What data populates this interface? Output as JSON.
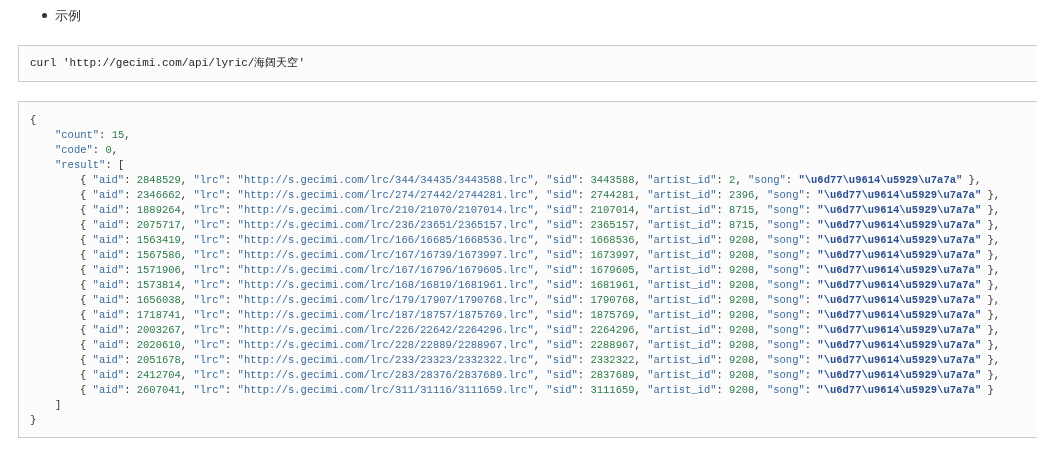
{
  "bullet": "示例",
  "command": "curl 'http://gecimi.com/api/lyric/海阔天空'",
  "code": {
    "lines": [
      {
        "tokens": [
          {
            "kind": "punct",
            "text": "{"
          }
        ],
        "children": [
          {
            "tokens": [
              {
                "kind": "key",
                "text": "\"count\""
              },
              {
                "kind": "punct",
                "text": ": "
              },
              {
                "kind": "num",
                "text": "15"
              },
              {
                "kind": "punct",
                "text": ","
              }
            ]
          },
          {
            "tokens": [
              {
                "kind": "key",
                "text": "\"code\""
              },
              {
                "kind": "punct",
                "text": ": "
              },
              {
                "kind": "num",
                "text": "0"
              },
              {
                "kind": "punct",
                "text": ","
              }
            ]
          },
          {
            "tokens": [
              {
                "kind": "key",
                "text": "\"result\""
              },
              {
                "kind": "punct",
                "text": ": ["
              }
            ],
            "children": [
              {
                "tokens": [
                  {
                    "kind": "punct",
                    "text": "{ "
                  },
                  {
                    "kind": "key",
                    "text": "\"aid\""
                  },
                  {
                    "kind": "punct",
                    "text": ": "
                  },
                  {
                    "kind": "num",
                    "text": "2848529"
                  },
                  {
                    "kind": "punct",
                    "text": ", "
                  },
                  {
                    "kind": "key",
                    "text": "\"lrc\""
                  },
                  {
                    "kind": "punct",
                    "text": ": "
                  },
                  {
                    "kind": "str",
                    "text": "\"http://s.gecimi.com/lrc/344/34435/3443588.lrc\""
                  },
                  {
                    "kind": "punct",
                    "text": ", "
                  },
                  {
                    "kind": "key",
                    "text": "\"sid\""
                  },
                  {
                    "kind": "punct",
                    "text": ": "
                  },
                  {
                    "kind": "num",
                    "text": "3443588"
                  },
                  {
                    "kind": "punct",
                    "text": ", "
                  },
                  {
                    "kind": "key",
                    "text": "\"artist_id\""
                  },
                  {
                    "kind": "punct",
                    "text": ": "
                  },
                  {
                    "kind": "num",
                    "text": "2"
                  },
                  {
                    "kind": "punct",
                    "text": ", "
                  },
                  {
                    "kind": "key",
                    "text": "\"song\""
                  },
                  {
                    "kind": "punct",
                    "text": ": "
                  },
                  {
                    "kind": "bold",
                    "text": "\"\\u6d77\\u9614\\u5929\\u7a7a\""
                  },
                  {
                    "kind": "punct",
                    "text": " },"
                  }
                ]
              },
              {
                "tokens": [
                  {
                    "kind": "punct",
                    "text": "{ "
                  },
                  {
                    "kind": "key",
                    "text": "\"aid\""
                  },
                  {
                    "kind": "punct",
                    "text": ": "
                  },
                  {
                    "kind": "num",
                    "text": "2346662"
                  },
                  {
                    "kind": "punct",
                    "text": ", "
                  },
                  {
                    "kind": "key",
                    "text": "\"lrc\""
                  },
                  {
                    "kind": "punct",
                    "text": ": "
                  },
                  {
                    "kind": "str",
                    "text": "\"http://s.gecimi.com/lrc/274/27442/2744281.lrc\""
                  },
                  {
                    "kind": "punct",
                    "text": ", "
                  },
                  {
                    "kind": "key",
                    "text": "\"sid\""
                  },
                  {
                    "kind": "punct",
                    "text": ": "
                  },
                  {
                    "kind": "num",
                    "text": "2744281"
                  },
                  {
                    "kind": "punct",
                    "text": ", "
                  },
                  {
                    "kind": "key",
                    "text": "\"artist_id\""
                  },
                  {
                    "kind": "punct",
                    "text": ": "
                  },
                  {
                    "kind": "num",
                    "text": "2396"
                  },
                  {
                    "kind": "punct",
                    "text": ", "
                  },
                  {
                    "kind": "key",
                    "text": "\"song\""
                  },
                  {
                    "kind": "punct",
                    "text": ": "
                  },
                  {
                    "kind": "bold",
                    "text": "\"\\u6d77\\u9614\\u5929\\u7a7a\""
                  },
                  {
                    "kind": "punct",
                    "text": " },"
                  }
                ]
              },
              {
                "tokens": [
                  {
                    "kind": "punct",
                    "text": "{ "
                  },
                  {
                    "kind": "key",
                    "text": "\"aid\""
                  },
                  {
                    "kind": "punct",
                    "text": ": "
                  },
                  {
                    "kind": "num",
                    "text": "1889264"
                  },
                  {
                    "kind": "punct",
                    "text": ", "
                  },
                  {
                    "kind": "key",
                    "text": "\"lrc\""
                  },
                  {
                    "kind": "punct",
                    "text": ": "
                  },
                  {
                    "kind": "str",
                    "text": "\"http://s.gecimi.com/lrc/210/21070/2107014.lrc\""
                  },
                  {
                    "kind": "punct",
                    "text": ", "
                  },
                  {
                    "kind": "key",
                    "text": "\"sid\""
                  },
                  {
                    "kind": "punct",
                    "text": ": "
                  },
                  {
                    "kind": "num",
                    "text": "2107014"
                  },
                  {
                    "kind": "punct",
                    "text": ", "
                  },
                  {
                    "kind": "key",
                    "text": "\"artist_id\""
                  },
                  {
                    "kind": "punct",
                    "text": ": "
                  },
                  {
                    "kind": "num",
                    "text": "8715"
                  },
                  {
                    "kind": "punct",
                    "text": ", "
                  },
                  {
                    "kind": "key",
                    "text": "\"song\""
                  },
                  {
                    "kind": "punct",
                    "text": ": "
                  },
                  {
                    "kind": "bold",
                    "text": "\"\\u6d77\\u9614\\u5929\\u7a7a\""
                  },
                  {
                    "kind": "punct",
                    "text": " },"
                  }
                ]
              },
              {
                "tokens": [
                  {
                    "kind": "punct",
                    "text": "{ "
                  },
                  {
                    "kind": "key",
                    "text": "\"aid\""
                  },
                  {
                    "kind": "punct",
                    "text": ": "
                  },
                  {
                    "kind": "num",
                    "text": "2075717"
                  },
                  {
                    "kind": "punct",
                    "text": ", "
                  },
                  {
                    "kind": "key",
                    "text": "\"lrc\""
                  },
                  {
                    "kind": "punct",
                    "text": ": "
                  },
                  {
                    "kind": "str",
                    "text": "\"http://s.gecimi.com/lrc/236/23651/2365157.lrc\""
                  },
                  {
                    "kind": "punct",
                    "text": ", "
                  },
                  {
                    "kind": "key",
                    "text": "\"sid\""
                  },
                  {
                    "kind": "punct",
                    "text": ": "
                  },
                  {
                    "kind": "num",
                    "text": "2365157"
                  },
                  {
                    "kind": "punct",
                    "text": ", "
                  },
                  {
                    "kind": "key",
                    "text": "\"artist_id\""
                  },
                  {
                    "kind": "punct",
                    "text": ": "
                  },
                  {
                    "kind": "num",
                    "text": "8715"
                  },
                  {
                    "kind": "punct",
                    "text": ", "
                  },
                  {
                    "kind": "key",
                    "text": "\"song\""
                  },
                  {
                    "kind": "punct",
                    "text": ": "
                  },
                  {
                    "kind": "bold",
                    "text": "\"\\u6d77\\u9614\\u5929\\u7a7a\""
                  },
                  {
                    "kind": "punct",
                    "text": " },"
                  }
                ]
              },
              {
                "tokens": [
                  {
                    "kind": "punct",
                    "text": "{ "
                  },
                  {
                    "kind": "key",
                    "text": "\"aid\""
                  },
                  {
                    "kind": "punct",
                    "text": ": "
                  },
                  {
                    "kind": "num",
                    "text": "1563419"
                  },
                  {
                    "kind": "punct",
                    "text": ", "
                  },
                  {
                    "kind": "key",
                    "text": "\"lrc\""
                  },
                  {
                    "kind": "punct",
                    "text": ": "
                  },
                  {
                    "kind": "str",
                    "text": "\"http://s.gecimi.com/lrc/166/16685/1668536.lrc\""
                  },
                  {
                    "kind": "punct",
                    "text": ", "
                  },
                  {
                    "kind": "key",
                    "text": "\"sid\""
                  },
                  {
                    "kind": "punct",
                    "text": ": "
                  },
                  {
                    "kind": "num",
                    "text": "1668536"
                  },
                  {
                    "kind": "punct",
                    "text": ", "
                  },
                  {
                    "kind": "key",
                    "text": "\"artist_id\""
                  },
                  {
                    "kind": "punct",
                    "text": ": "
                  },
                  {
                    "kind": "num",
                    "text": "9208"
                  },
                  {
                    "kind": "punct",
                    "text": ", "
                  },
                  {
                    "kind": "key",
                    "text": "\"song\""
                  },
                  {
                    "kind": "punct",
                    "text": ": "
                  },
                  {
                    "kind": "bold",
                    "text": "\"\\u6d77\\u9614\\u5929\\u7a7a\""
                  },
                  {
                    "kind": "punct",
                    "text": " },"
                  }
                ]
              },
              {
                "tokens": [
                  {
                    "kind": "punct",
                    "text": "{ "
                  },
                  {
                    "kind": "key",
                    "text": "\"aid\""
                  },
                  {
                    "kind": "punct",
                    "text": ": "
                  },
                  {
                    "kind": "num",
                    "text": "1567586"
                  },
                  {
                    "kind": "punct",
                    "text": ", "
                  },
                  {
                    "kind": "key",
                    "text": "\"lrc\""
                  },
                  {
                    "kind": "punct",
                    "text": ": "
                  },
                  {
                    "kind": "str",
                    "text": "\"http://s.gecimi.com/lrc/167/16739/1673997.lrc\""
                  },
                  {
                    "kind": "punct",
                    "text": ", "
                  },
                  {
                    "kind": "key",
                    "text": "\"sid\""
                  },
                  {
                    "kind": "punct",
                    "text": ": "
                  },
                  {
                    "kind": "num",
                    "text": "1673997"
                  },
                  {
                    "kind": "punct",
                    "text": ", "
                  },
                  {
                    "kind": "key",
                    "text": "\"artist_id\""
                  },
                  {
                    "kind": "punct",
                    "text": ": "
                  },
                  {
                    "kind": "num",
                    "text": "9208"
                  },
                  {
                    "kind": "punct",
                    "text": ", "
                  },
                  {
                    "kind": "key",
                    "text": "\"song\""
                  },
                  {
                    "kind": "punct",
                    "text": ": "
                  },
                  {
                    "kind": "bold",
                    "text": "\"\\u6d77\\u9614\\u5929\\u7a7a\""
                  },
                  {
                    "kind": "punct",
                    "text": " },"
                  }
                ]
              },
              {
                "tokens": [
                  {
                    "kind": "punct",
                    "text": "{ "
                  },
                  {
                    "kind": "key",
                    "text": "\"aid\""
                  },
                  {
                    "kind": "punct",
                    "text": ": "
                  },
                  {
                    "kind": "num",
                    "text": "1571906"
                  },
                  {
                    "kind": "punct",
                    "text": ", "
                  },
                  {
                    "kind": "key",
                    "text": "\"lrc\""
                  },
                  {
                    "kind": "punct",
                    "text": ": "
                  },
                  {
                    "kind": "str",
                    "text": "\"http://s.gecimi.com/lrc/167/16796/1679605.lrc\""
                  },
                  {
                    "kind": "punct",
                    "text": ", "
                  },
                  {
                    "kind": "key",
                    "text": "\"sid\""
                  },
                  {
                    "kind": "punct",
                    "text": ": "
                  },
                  {
                    "kind": "num",
                    "text": "1679605"
                  },
                  {
                    "kind": "punct",
                    "text": ", "
                  },
                  {
                    "kind": "key",
                    "text": "\"artist_id\""
                  },
                  {
                    "kind": "punct",
                    "text": ": "
                  },
                  {
                    "kind": "num",
                    "text": "9208"
                  },
                  {
                    "kind": "punct",
                    "text": ", "
                  },
                  {
                    "kind": "key",
                    "text": "\"song\""
                  },
                  {
                    "kind": "punct",
                    "text": ": "
                  },
                  {
                    "kind": "bold",
                    "text": "\"\\u6d77\\u9614\\u5929\\u7a7a\""
                  },
                  {
                    "kind": "punct",
                    "text": " },"
                  }
                ]
              },
              {
                "tokens": [
                  {
                    "kind": "punct",
                    "text": "{ "
                  },
                  {
                    "kind": "key",
                    "text": "\"aid\""
                  },
                  {
                    "kind": "punct",
                    "text": ": "
                  },
                  {
                    "kind": "num",
                    "text": "1573814"
                  },
                  {
                    "kind": "punct",
                    "text": ", "
                  },
                  {
                    "kind": "key",
                    "text": "\"lrc\""
                  },
                  {
                    "kind": "punct",
                    "text": ": "
                  },
                  {
                    "kind": "str",
                    "text": "\"http://s.gecimi.com/lrc/168/16819/1681961.lrc\""
                  },
                  {
                    "kind": "punct",
                    "text": ", "
                  },
                  {
                    "kind": "key",
                    "text": "\"sid\""
                  },
                  {
                    "kind": "punct",
                    "text": ": "
                  },
                  {
                    "kind": "num",
                    "text": "1681961"
                  },
                  {
                    "kind": "punct",
                    "text": ", "
                  },
                  {
                    "kind": "key",
                    "text": "\"artist_id\""
                  },
                  {
                    "kind": "punct",
                    "text": ": "
                  },
                  {
                    "kind": "num",
                    "text": "9208"
                  },
                  {
                    "kind": "punct",
                    "text": ", "
                  },
                  {
                    "kind": "key",
                    "text": "\"song\""
                  },
                  {
                    "kind": "punct",
                    "text": ": "
                  },
                  {
                    "kind": "bold",
                    "text": "\"\\u6d77\\u9614\\u5929\\u7a7a\""
                  },
                  {
                    "kind": "punct",
                    "text": " },"
                  }
                ]
              },
              {
                "tokens": [
                  {
                    "kind": "punct",
                    "text": "{ "
                  },
                  {
                    "kind": "key",
                    "text": "\"aid\""
                  },
                  {
                    "kind": "punct",
                    "text": ": "
                  },
                  {
                    "kind": "num",
                    "text": "1656038"
                  },
                  {
                    "kind": "punct",
                    "text": ", "
                  },
                  {
                    "kind": "key",
                    "text": "\"lrc\""
                  },
                  {
                    "kind": "punct",
                    "text": ": "
                  },
                  {
                    "kind": "str",
                    "text": "\"http://s.gecimi.com/lrc/179/17907/1790768.lrc\""
                  },
                  {
                    "kind": "punct",
                    "text": ", "
                  },
                  {
                    "kind": "key",
                    "text": "\"sid\""
                  },
                  {
                    "kind": "punct",
                    "text": ": "
                  },
                  {
                    "kind": "num",
                    "text": "1790768"
                  },
                  {
                    "kind": "punct",
                    "text": ", "
                  },
                  {
                    "kind": "key",
                    "text": "\"artist_id\""
                  },
                  {
                    "kind": "punct",
                    "text": ": "
                  },
                  {
                    "kind": "num",
                    "text": "9208"
                  },
                  {
                    "kind": "punct",
                    "text": ", "
                  },
                  {
                    "kind": "key",
                    "text": "\"song\""
                  },
                  {
                    "kind": "punct",
                    "text": ": "
                  },
                  {
                    "kind": "bold",
                    "text": "\"\\u6d77\\u9614\\u5929\\u7a7a\""
                  },
                  {
                    "kind": "punct",
                    "text": " },"
                  }
                ]
              },
              {
                "tokens": [
                  {
                    "kind": "punct",
                    "text": "{ "
                  },
                  {
                    "kind": "key",
                    "text": "\"aid\""
                  },
                  {
                    "kind": "punct",
                    "text": ": "
                  },
                  {
                    "kind": "num",
                    "text": "1718741"
                  },
                  {
                    "kind": "punct",
                    "text": ", "
                  },
                  {
                    "kind": "key",
                    "text": "\"lrc\""
                  },
                  {
                    "kind": "punct",
                    "text": ": "
                  },
                  {
                    "kind": "str",
                    "text": "\"http://s.gecimi.com/lrc/187/18757/1875769.lrc\""
                  },
                  {
                    "kind": "punct",
                    "text": ", "
                  },
                  {
                    "kind": "key",
                    "text": "\"sid\""
                  },
                  {
                    "kind": "punct",
                    "text": ": "
                  },
                  {
                    "kind": "num",
                    "text": "1875769"
                  },
                  {
                    "kind": "punct",
                    "text": ", "
                  },
                  {
                    "kind": "key",
                    "text": "\"artist_id\""
                  },
                  {
                    "kind": "punct",
                    "text": ": "
                  },
                  {
                    "kind": "num",
                    "text": "9208"
                  },
                  {
                    "kind": "punct",
                    "text": ", "
                  },
                  {
                    "kind": "key",
                    "text": "\"song\""
                  },
                  {
                    "kind": "punct",
                    "text": ": "
                  },
                  {
                    "kind": "bold",
                    "text": "\"\\u6d77\\u9614\\u5929\\u7a7a\""
                  },
                  {
                    "kind": "punct",
                    "text": " },"
                  }
                ]
              },
              {
                "tokens": [
                  {
                    "kind": "punct",
                    "text": "{ "
                  },
                  {
                    "kind": "key",
                    "text": "\"aid\""
                  },
                  {
                    "kind": "punct",
                    "text": ": "
                  },
                  {
                    "kind": "num",
                    "text": "2003267"
                  },
                  {
                    "kind": "punct",
                    "text": ", "
                  },
                  {
                    "kind": "key",
                    "text": "\"lrc\""
                  },
                  {
                    "kind": "punct",
                    "text": ": "
                  },
                  {
                    "kind": "str",
                    "text": "\"http://s.gecimi.com/lrc/226/22642/2264296.lrc\""
                  },
                  {
                    "kind": "punct",
                    "text": ", "
                  },
                  {
                    "kind": "key",
                    "text": "\"sid\""
                  },
                  {
                    "kind": "punct",
                    "text": ": "
                  },
                  {
                    "kind": "num",
                    "text": "2264296"
                  },
                  {
                    "kind": "punct",
                    "text": ", "
                  },
                  {
                    "kind": "key",
                    "text": "\"artist_id\""
                  },
                  {
                    "kind": "punct",
                    "text": ": "
                  },
                  {
                    "kind": "num",
                    "text": "9208"
                  },
                  {
                    "kind": "punct",
                    "text": ", "
                  },
                  {
                    "kind": "key",
                    "text": "\"song\""
                  },
                  {
                    "kind": "punct",
                    "text": ": "
                  },
                  {
                    "kind": "bold",
                    "text": "\"\\u6d77\\u9614\\u5929\\u7a7a\""
                  },
                  {
                    "kind": "punct",
                    "text": " },"
                  }
                ]
              },
              {
                "tokens": [
                  {
                    "kind": "punct",
                    "text": "{ "
                  },
                  {
                    "kind": "key",
                    "text": "\"aid\""
                  },
                  {
                    "kind": "punct",
                    "text": ": "
                  },
                  {
                    "kind": "num",
                    "text": "2020610"
                  },
                  {
                    "kind": "punct",
                    "text": ", "
                  },
                  {
                    "kind": "key",
                    "text": "\"lrc\""
                  },
                  {
                    "kind": "punct",
                    "text": ": "
                  },
                  {
                    "kind": "str",
                    "text": "\"http://s.gecimi.com/lrc/228/22889/2288967.lrc\""
                  },
                  {
                    "kind": "punct",
                    "text": ", "
                  },
                  {
                    "kind": "key",
                    "text": "\"sid\""
                  },
                  {
                    "kind": "punct",
                    "text": ": "
                  },
                  {
                    "kind": "num",
                    "text": "2288967"
                  },
                  {
                    "kind": "punct",
                    "text": ", "
                  },
                  {
                    "kind": "key",
                    "text": "\"artist_id\""
                  },
                  {
                    "kind": "punct",
                    "text": ": "
                  },
                  {
                    "kind": "num",
                    "text": "9208"
                  },
                  {
                    "kind": "punct",
                    "text": ", "
                  },
                  {
                    "kind": "key",
                    "text": "\"song\""
                  },
                  {
                    "kind": "punct",
                    "text": ": "
                  },
                  {
                    "kind": "bold",
                    "text": "\"\\u6d77\\u9614\\u5929\\u7a7a\""
                  },
                  {
                    "kind": "punct",
                    "text": " },"
                  }
                ]
              },
              {
                "tokens": [
                  {
                    "kind": "punct",
                    "text": "{ "
                  },
                  {
                    "kind": "key",
                    "text": "\"aid\""
                  },
                  {
                    "kind": "punct",
                    "text": ": "
                  },
                  {
                    "kind": "num",
                    "text": "2051678"
                  },
                  {
                    "kind": "punct",
                    "text": ", "
                  },
                  {
                    "kind": "key",
                    "text": "\"lrc\""
                  },
                  {
                    "kind": "punct",
                    "text": ": "
                  },
                  {
                    "kind": "str",
                    "text": "\"http://s.gecimi.com/lrc/233/23323/2332322.lrc\""
                  },
                  {
                    "kind": "punct",
                    "text": ", "
                  },
                  {
                    "kind": "key",
                    "text": "\"sid\""
                  },
                  {
                    "kind": "punct",
                    "text": ": "
                  },
                  {
                    "kind": "num",
                    "text": "2332322"
                  },
                  {
                    "kind": "punct",
                    "text": ", "
                  },
                  {
                    "kind": "key",
                    "text": "\"artist_id\""
                  },
                  {
                    "kind": "punct",
                    "text": ": "
                  },
                  {
                    "kind": "num",
                    "text": "9208"
                  },
                  {
                    "kind": "punct",
                    "text": ", "
                  },
                  {
                    "kind": "key",
                    "text": "\"song\""
                  },
                  {
                    "kind": "punct",
                    "text": ": "
                  },
                  {
                    "kind": "bold",
                    "text": "\"\\u6d77\\u9614\\u5929\\u7a7a\""
                  },
                  {
                    "kind": "punct",
                    "text": " },"
                  }
                ]
              },
              {
                "tokens": [
                  {
                    "kind": "punct",
                    "text": "{ "
                  },
                  {
                    "kind": "key",
                    "text": "\"aid\""
                  },
                  {
                    "kind": "punct",
                    "text": ": "
                  },
                  {
                    "kind": "num",
                    "text": "2412704"
                  },
                  {
                    "kind": "punct",
                    "text": ", "
                  },
                  {
                    "kind": "key",
                    "text": "\"lrc\""
                  },
                  {
                    "kind": "punct",
                    "text": ": "
                  },
                  {
                    "kind": "str",
                    "text": "\"http://s.gecimi.com/lrc/283/28376/2837689.lrc\""
                  },
                  {
                    "kind": "punct",
                    "text": ", "
                  },
                  {
                    "kind": "key",
                    "text": "\"sid\""
                  },
                  {
                    "kind": "punct",
                    "text": ": "
                  },
                  {
                    "kind": "num",
                    "text": "2837689"
                  },
                  {
                    "kind": "punct",
                    "text": ", "
                  },
                  {
                    "kind": "key",
                    "text": "\"artist_id\""
                  },
                  {
                    "kind": "punct",
                    "text": ": "
                  },
                  {
                    "kind": "num",
                    "text": "9208"
                  },
                  {
                    "kind": "punct",
                    "text": ", "
                  },
                  {
                    "kind": "key",
                    "text": "\"song\""
                  },
                  {
                    "kind": "punct",
                    "text": ": "
                  },
                  {
                    "kind": "bold",
                    "text": "\"\\u6d77\\u9614\\u5929\\u7a7a\""
                  },
                  {
                    "kind": "punct",
                    "text": " },"
                  }
                ]
              },
              {
                "tokens": [
                  {
                    "kind": "punct",
                    "text": "{ "
                  },
                  {
                    "kind": "key",
                    "text": "\"aid\""
                  },
                  {
                    "kind": "punct",
                    "text": ": "
                  },
                  {
                    "kind": "num",
                    "text": "2607041"
                  },
                  {
                    "kind": "punct",
                    "text": ", "
                  },
                  {
                    "kind": "key",
                    "text": "\"lrc\""
                  },
                  {
                    "kind": "punct",
                    "text": ": "
                  },
                  {
                    "kind": "str",
                    "text": "\"http://s.gecimi.com/lrc/311/31116/3111659.lrc\""
                  },
                  {
                    "kind": "punct",
                    "text": ", "
                  },
                  {
                    "kind": "key",
                    "text": "\"sid\""
                  },
                  {
                    "kind": "punct",
                    "text": ": "
                  },
                  {
                    "kind": "num",
                    "text": "3111659"
                  },
                  {
                    "kind": "punct",
                    "text": ", "
                  },
                  {
                    "kind": "key",
                    "text": "\"artist_id\""
                  },
                  {
                    "kind": "punct",
                    "text": ": "
                  },
                  {
                    "kind": "num",
                    "text": "9208"
                  },
                  {
                    "kind": "punct",
                    "text": ", "
                  },
                  {
                    "kind": "key",
                    "text": "\"song\""
                  },
                  {
                    "kind": "punct",
                    "text": ": "
                  },
                  {
                    "kind": "bold",
                    "text": "\"\\u6d77\\u9614\\u5929\\u7a7a\""
                  },
                  {
                    "kind": "punct",
                    "text": " }"
                  }
                ]
              }
            ]
          },
          {
            "tokens": [
              {
                "kind": "punct",
                "text": "]"
              }
            ]
          }
        ]
      },
      {
        "tokens": [
          {
            "kind": "punct",
            "text": "}"
          }
        ]
      }
    ]
  }
}
